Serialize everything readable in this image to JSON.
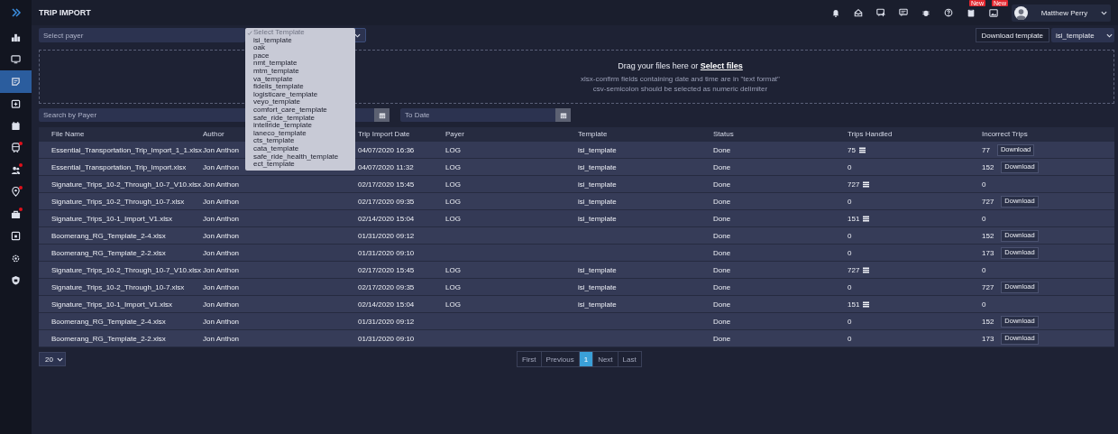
{
  "sidebar": {
    "items": [
      {
        "kind": "chart",
        "selected": false,
        "alert": false
      },
      {
        "kind": "monitor",
        "selected": false,
        "alert": false
      },
      {
        "kind": "note",
        "selected": true,
        "alert": false
      },
      {
        "kind": "calendar-plus",
        "selected": false,
        "alert": false
      },
      {
        "kind": "calendar",
        "selected": false,
        "alert": false
      },
      {
        "kind": "bus",
        "selected": false,
        "alert": true
      },
      {
        "kind": "users",
        "selected": false,
        "alert": true
      },
      {
        "kind": "pin",
        "selected": false,
        "alert": true
      },
      {
        "kind": "briefcase",
        "selected": false,
        "alert": true
      },
      {
        "kind": "calendar-box",
        "selected": false,
        "alert": false
      },
      {
        "kind": "gear",
        "selected": false,
        "alert": false
      },
      {
        "kind": "shield",
        "selected": false,
        "alert": false
      }
    ]
  },
  "header": {
    "title": "TRIP IMPORT",
    "icons": [
      {
        "kind": "bell"
      },
      {
        "kind": "inbox"
      },
      {
        "kind": "chat-plus"
      },
      {
        "kind": "chat"
      },
      {
        "kind": "bug"
      },
      {
        "kind": "help"
      },
      {
        "kind": "clipboard",
        "badge": "New"
      },
      {
        "kind": "image",
        "badge": "New"
      }
    ],
    "user": {
      "name": "Matthew Perry"
    }
  },
  "toolbar": {
    "payer_select": {
      "placeholder": "Select payer"
    },
    "download_button": "Download template",
    "template_select": {
      "value": "isi_template"
    }
  },
  "template_dropdown": {
    "items": [
      {
        "label": "Select Template",
        "selected": true
      },
      {
        "label": "isi_template",
        "selected": false
      },
      {
        "label": "oak",
        "selected": false
      },
      {
        "label": "pace",
        "selected": false
      },
      {
        "label": "nmt_template",
        "selected": false
      },
      {
        "label": "mtm_template",
        "selected": false
      },
      {
        "label": "va_template",
        "selected": false
      },
      {
        "label": "fidelis_template",
        "selected": false
      },
      {
        "label": "logisticare_template",
        "selected": false
      },
      {
        "label": "veyo_template",
        "selected": false
      },
      {
        "label": "comfort_care_template",
        "selected": false
      },
      {
        "label": "safe_ride_template",
        "selected": false
      },
      {
        "label": "intellride_template",
        "selected": false
      },
      {
        "label": "laneco_template",
        "selected": false
      },
      {
        "label": "cts_template",
        "selected": false
      },
      {
        "label": "cata_template",
        "selected": false
      },
      {
        "label": "safe_ride_health_template",
        "selected": false
      },
      {
        "label": "ect_template",
        "selected": false
      }
    ]
  },
  "upload": {
    "prompt": "Drag your files here or",
    "link": "Select files",
    "notes": [
      "xlsx-confirm fields containing date and time are in \"text format\"",
      "csv-semicolon should be selected as numeric delimiter"
    ]
  },
  "filters": {
    "payer_search": {
      "placeholder": "Search by Payer"
    },
    "to_date": {
      "placeholder": "To Date"
    }
  },
  "table": {
    "columns": [
      "File Name",
      "Author",
      "Trip Import Date",
      "Payer",
      "Template",
      "Status",
      "Trips Handled",
      "Incorrect Trips"
    ],
    "rows": [
      {
        "file": "Essential_Transportation_Trip_Import_1_1.xlsx",
        "author": "Jon Anthon",
        "date": "04/07/2020 16:36",
        "payer": "LOG",
        "template": "isi_template",
        "status": "Done",
        "trips": "75",
        "trips_list": true,
        "incorrect": "77",
        "action": "Download"
      },
      {
        "file": "Essential_Transportation_Trip_Import.xlsx",
        "author": "Jon Anthon",
        "date": "04/07/2020 11:32",
        "payer": "LOG",
        "template": "isi_template",
        "status": "Done",
        "trips": "0",
        "trips_list": false,
        "incorrect": "152",
        "action": "Download"
      },
      {
        "file": "Signature_Trips_10-2_Through_10-7_V10.xlsx",
        "author": "Jon Anthon",
        "date": "02/17/2020 15:45",
        "payer": "LOG",
        "template": "isi_template",
        "status": "Done",
        "trips": "727",
        "trips_list": true,
        "incorrect": "0"
      },
      {
        "file": "Signature_Trips_10-2_Through_10-7.xlsx",
        "author": "Jon Anthon",
        "date": "02/17/2020 09:35",
        "payer": "LOG",
        "template": "isi_template",
        "status": "Done",
        "trips": "0",
        "trips_list": false,
        "incorrect": "727",
        "action": "Download"
      },
      {
        "file": "Signature_Trips_10-1_Import_V1.xlsx",
        "author": "Jon Anthon",
        "date": "02/14/2020 15:04",
        "payer": "LOG",
        "template": "isi_template",
        "status": "Done",
        "trips": "151",
        "trips_list": true,
        "incorrect": "0"
      },
      {
        "file": "Boomerang_RG_Template_2-4.xlsx",
        "author": "Jon Anthon",
        "date": "01/31/2020 09:12",
        "status": "Done",
        "trips": "0",
        "trips_list": false,
        "incorrect": "152",
        "action": "Download"
      },
      {
        "file": "Boomerang_RG_Template_2-2.xlsx",
        "author": "Jon Anthon",
        "date": "01/31/2020 09:10",
        "status": "Done",
        "trips": "0",
        "trips_list": false,
        "incorrect": "173",
        "action": "Download"
      },
      {
        "file": "Signature_Trips_10-2_Through_10-7_V10.xlsx",
        "author": "Jon Anthon",
        "date": "02/17/2020 15:45",
        "payer": "LOG",
        "template": "isi_template",
        "status": "Done",
        "trips": "727",
        "trips_list": true,
        "incorrect": "0"
      },
      {
        "file": "Signature_Trips_10-2_Through_10-7.xlsx",
        "author": "Jon Anthon",
        "date": "02/17/2020 09:35",
        "payer": "LOG",
        "template": "isi_template",
        "status": "Done",
        "trips": "0",
        "trips_list": false,
        "incorrect": "727",
        "action": "Download"
      },
      {
        "file": "Signature_Trips_10-1_Import_V1.xlsx",
        "author": "Jon Anthon",
        "date": "02/14/2020 15:04",
        "payer": "LOG",
        "template": "isi_template",
        "status": "Done",
        "trips": "151",
        "trips_list": true,
        "incorrect": "0"
      },
      {
        "file": "Boomerang_RG_Template_2-4.xlsx",
        "author": "Jon Anthon",
        "date": "01/31/2020 09:12",
        "status": "Done",
        "trips": "0",
        "trips_list": false,
        "incorrect": "152",
        "action": "Download"
      },
      {
        "file": "Boomerang_RG_Template_2-2.xlsx",
        "author": "Jon Anthon",
        "date": "01/31/2020 09:10",
        "status": "Done",
        "trips": "0",
        "trips_list": false,
        "incorrect": "173",
        "action": "Download"
      }
    ]
  },
  "footer": {
    "page_size": "20",
    "pages": [
      {
        "label": "First",
        "selected": false
      },
      {
        "label": "Previous",
        "selected": false
      },
      {
        "label": "1",
        "selected": true
      },
      {
        "label": "Next",
        "selected": false
      },
      {
        "label": "Last",
        "selected": false
      }
    ]
  }
}
